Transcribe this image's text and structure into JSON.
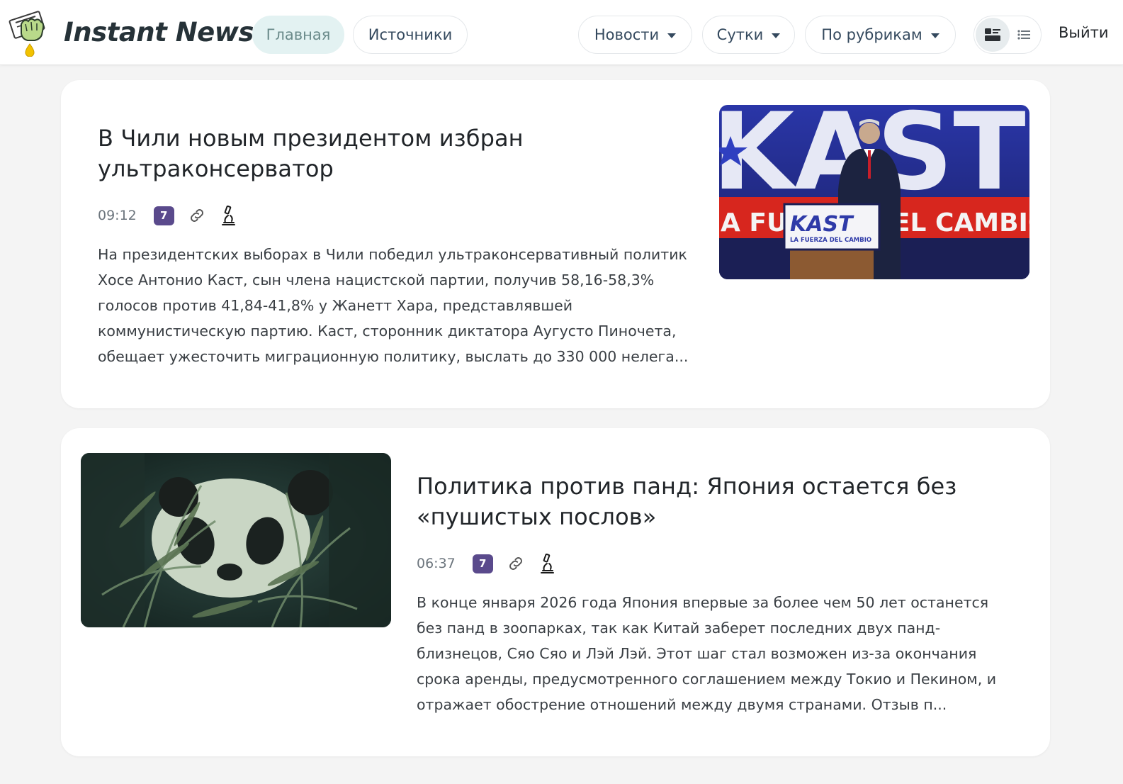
{
  "header": {
    "brand": "Instant News",
    "nav": {
      "home": "Главная",
      "sources": "Источники"
    },
    "dropdowns": {
      "news": "Новости",
      "period": "Сутки",
      "rubrics": "По рубрикам"
    },
    "logout": "Выйти",
    "icons": {
      "logo": "fist-with-newspaper-logo",
      "view_cards": "card-view-icon",
      "view_list": "list-view-icon"
    }
  },
  "articles": [
    {
      "title": "В Чили новым президентом избран ультраконсерватор",
      "time": "09:12",
      "badge": "7",
      "text": "На президентских выборах в Чили победил ультраконсервативный политик Хосе Антонио Каст, сын члена нацистской партии, получив 58,16-58,3% голосов против 41,84-41,8% у Жанетт Хара, представлявшей коммунистическую партию. Каст, сторонник диктатора Аугусто Пиночета, обещает ужесточить миграционную политику, выслать до 330 000 нелега...",
      "image": {
        "big_letters": "KAST",
        "banner_text": "A FUERZA DEL CAMBIO",
        "podium_title": "KAST",
        "podium_sub": "LA FUERZA DEL CAMBIO"
      }
    },
    {
      "title": "Политика против панд: Япония остается без «пушистых послов»",
      "time": "06:37",
      "badge": "7",
      "text": "В конце января 2026 года Япония впервые за более чем 50 лет останется без панд в зоопарках, так как Китай заберет последних двух панд-близнецов, Сяо Сяо и Лэй Лэй. Этот шаг стал возможен из-за окончания срока аренды, предусмотренного соглашением между Токио и Пекином, и отражает обострение отношений между двумя странами. Отзыв п..."
    }
  ],
  "colors": {
    "badge": "#5a4a8c",
    "active_pill": "#e3f2f2",
    "page_bg": "#f4f4f4"
  }
}
